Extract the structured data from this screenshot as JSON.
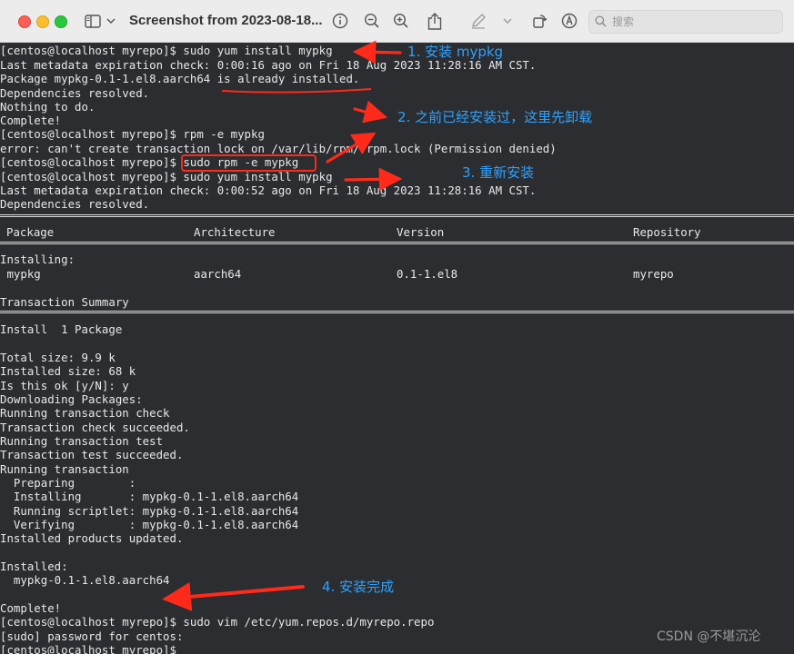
{
  "window": {
    "title": "Screenshot from 2023-08-18...",
    "search_placeholder": "搜索",
    "icons": [
      "sidebar-icon",
      "chevron-down-icon",
      "info-icon",
      "zoom-out-icon",
      "zoom-in-icon",
      "share-icon",
      "markup-pen-icon",
      "chevron-down-icon",
      "rotate-icon",
      "annotate-icon",
      "search-icon"
    ]
  },
  "terminal": {
    "lines": [
      "[centos@localhost myrepo]$ sudo yum install mypkg",
      "Last metadata expiration check: 0:00:16 ago on Fri 18 Aug 2023 11:28:16 AM CST.",
      "Package mypkg-0.1-1.el8.aarch64 is already installed.",
      "Dependencies resolved.",
      "Nothing to do.",
      "Complete!",
      "[centos@localhost myrepo]$ rpm -e mypkg",
      "error: can't create transaction lock on /var/lib/rpm/.rpm.lock (Permission denied)",
      "[centos@localhost myrepo]$ sudo rpm -e mypkg",
      "[centos@localhost myrepo]$ sudo yum install mypkg",
      "Last metadata expiration check: 0:00:52 ago on Fri 18 Aug 2023 11:28:16 AM CST.",
      "Dependencies resolved."
    ],
    "table_header": {
      "package": "Package",
      "architecture": "Architecture",
      "version": "Version",
      "repository": "Repository"
    },
    "installing_label": "Installing:",
    "table_row": {
      "package": " mypkg",
      "architecture": "aarch64",
      "version": "0.1-1.el8",
      "repository": "myrepo"
    },
    "transaction_summary": "Transaction Summary",
    "install_count": "Install  1 Package",
    "lines_after": [
      "Total size: 9.9 k",
      "Installed size: 68 k",
      "Is this ok [y/N]: y",
      "Downloading Packages:",
      "Running transaction check",
      "Transaction check succeeded.",
      "Running transaction test",
      "Transaction test succeeded.",
      "Running transaction",
      "  Preparing        :",
      "  Installing       : mypkg-0.1-1.el8.aarch64",
      "  Running scriptlet: mypkg-0.1-1.el8.aarch64",
      "  Verifying        : mypkg-0.1-1.el8.aarch64",
      "Installed products updated."
    ],
    "installed_label": "Installed:",
    "installed_pkg": "  mypkg-0.1-1.el8.aarch64",
    "complete": "Complete!",
    "final_lines": [
      "[centos@localhost myrepo]$ sudo vim /etc/yum.repos.d/myrepo.repo",
      "[sudo] password for centos:",
      "[centos@localhost myrepo]$"
    ]
  },
  "annotations": {
    "a1": "1. 安装 mypkg",
    "a2": "2. 之前已经安装过，这里先卸载",
    "a3": "3. 重新安装",
    "a4": "4. 安装完成",
    "color": "#2ea2ff",
    "arrow_color": "#ff2a1a"
  },
  "watermark": "CSDN @不堪沉沦"
}
